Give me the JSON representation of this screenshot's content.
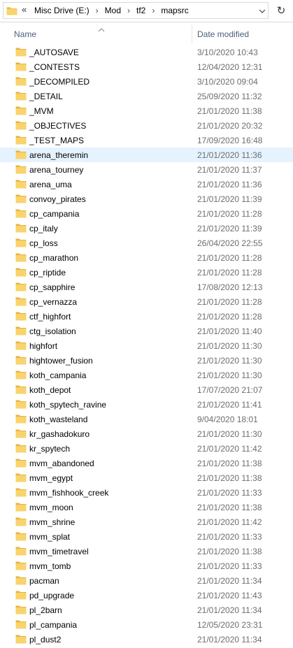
{
  "address_bar": {
    "overflow_glyph": "«",
    "breadcrumbs": [
      "Misc Drive (E:)",
      "Mod",
      "tf2",
      "mapsrc"
    ],
    "separator_glyph": "›",
    "dropdown_glyph": "⌄",
    "refresh_glyph": "↻"
  },
  "columns": {
    "name": "Name",
    "date": "Date modified",
    "sort_indicator": "ascending"
  },
  "colors": {
    "folder": "#f9d36c",
    "folder_dark": "#e8b23c",
    "selection": "#e5f3ff",
    "header_text": "#4c607a"
  },
  "files": [
    {
      "name": "_AUTOSAVE",
      "date": "3/10/2020 10:43"
    },
    {
      "name": "_CONTESTS",
      "date": "12/04/2020 12:31"
    },
    {
      "name": "_DECOMPILED",
      "date": "3/10/2020 09:04"
    },
    {
      "name": "_DETAIL",
      "date": "25/09/2020 11:32"
    },
    {
      "name": "_MVM",
      "date": "21/01/2020 11:38"
    },
    {
      "name": "_OBJECTIVES",
      "date": "21/01/2020 20:32"
    },
    {
      "name": "_TEST_MAPS",
      "date": "17/09/2020 16:48"
    },
    {
      "name": "arena_theremin",
      "date": "21/01/2020 11:36",
      "selected": true
    },
    {
      "name": "arena_tourney",
      "date": "21/01/2020 11:37"
    },
    {
      "name": "arena_uma",
      "date": "21/01/2020 11:36"
    },
    {
      "name": "convoy_pirates",
      "date": "21/01/2020 11:39"
    },
    {
      "name": "cp_campania",
      "date": "21/01/2020 11:28"
    },
    {
      "name": "cp_italy",
      "date": "21/01/2020 11:39"
    },
    {
      "name": "cp_loss",
      "date": "26/04/2020 22:55"
    },
    {
      "name": "cp_marathon",
      "date": "21/01/2020 11:28"
    },
    {
      "name": "cp_riptide",
      "date": "21/01/2020 11:28"
    },
    {
      "name": "cp_sapphire",
      "date": "17/08/2020 12:13"
    },
    {
      "name": "cp_vernazza",
      "date": "21/01/2020 11:28"
    },
    {
      "name": "ctf_highfort",
      "date": "21/01/2020 11:28"
    },
    {
      "name": "ctg_isolation",
      "date": "21/01/2020 11:40"
    },
    {
      "name": "highfort",
      "date": "21/01/2020 11:30"
    },
    {
      "name": "hightower_fusion",
      "date": "21/01/2020 11:30"
    },
    {
      "name": "koth_campania",
      "date": "21/01/2020 11:30"
    },
    {
      "name": "koth_depot",
      "date": "17/07/2020 21:07"
    },
    {
      "name": "koth_spytech_ravine",
      "date": "21/01/2020 11:41"
    },
    {
      "name": "koth_wasteland",
      "date": "9/04/2020 18:01"
    },
    {
      "name": "kr_gashadokuro",
      "date": "21/01/2020 11:30"
    },
    {
      "name": "kr_spytech",
      "date": "21/01/2020 11:42"
    },
    {
      "name": "mvm_abandoned",
      "date": "21/01/2020 11:38"
    },
    {
      "name": "mvm_egypt",
      "date": "21/01/2020 11:38"
    },
    {
      "name": "mvm_fishhook_creek",
      "date": "21/01/2020 11:33"
    },
    {
      "name": "mvm_moon",
      "date": "21/01/2020 11:38"
    },
    {
      "name": "mvm_shrine",
      "date": "21/01/2020 11:42"
    },
    {
      "name": "mvm_splat",
      "date": "21/01/2020 11:33"
    },
    {
      "name": "mvm_timetravel",
      "date": "21/01/2020 11:38"
    },
    {
      "name": "mvm_tomb",
      "date": "21/01/2020 11:33"
    },
    {
      "name": "pacman",
      "date": "21/01/2020 11:34"
    },
    {
      "name": "pd_upgrade",
      "date": "21/01/2020 11:43"
    },
    {
      "name": "pl_2barn",
      "date": "21/01/2020 11:34"
    },
    {
      "name": "pl_campania",
      "date": "12/05/2020 23:31"
    },
    {
      "name": "pl_dust2",
      "date": "21/01/2020 11:34"
    }
  ]
}
